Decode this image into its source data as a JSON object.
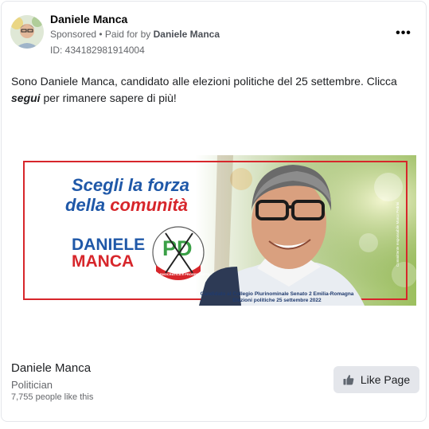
{
  "header": {
    "page_name": "Daniele Manca",
    "sponsored_label": "Sponsored",
    "paid_for_prefix": " • Paid for by ",
    "paid_for_name": "Daniele Manca",
    "ad_id": "ID: 434182981914004",
    "more_label": "•••"
  },
  "body": {
    "text_before": "Sono Daniele Manca, candidato alle elezioni politiche del 25 settembre. Clicca ",
    "emphasis": "segui",
    "text_after": " per rimanere sapere di più!"
  },
  "banner": {
    "headline_1": "Scegli la forza",
    "headline_2a": "della ",
    "headline_2b": "comunità",
    "candidate_first": "DANIELE",
    "candidate_last": "MANCA",
    "logo_letters": "PD",
    "logo_sub": "ITALIA DEMOCRATICA E PROGRESSISTA",
    "caption_1": "Candidato al Collegio Plurinominale Senato 2 Emilia-Romagna",
    "caption_2": "Elezioni politiche 25 settembre 2022",
    "side_note": "Committente responsabile Marco Pedrini",
    "colors": {
      "blue": "#1f58a8",
      "red": "#d7262b",
      "green": "#3aa046"
    }
  },
  "footer": {
    "page_name": "Daniele Manca",
    "category": "Politician",
    "likes": "7,755 people like this",
    "like_button_label": "Like Page"
  }
}
